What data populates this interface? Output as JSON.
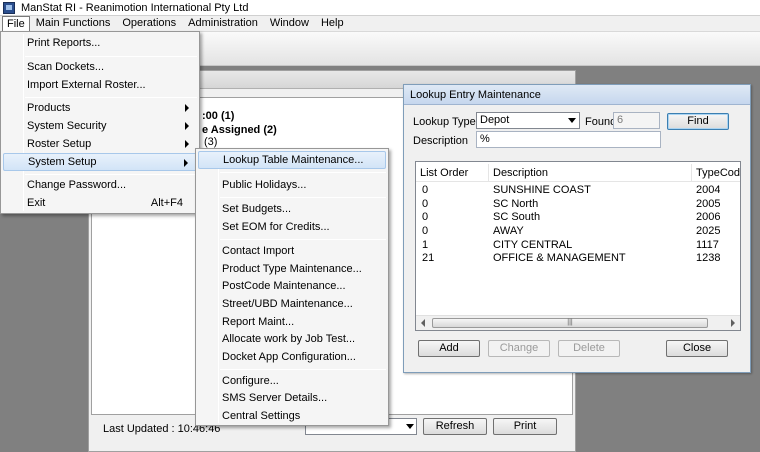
{
  "window": {
    "title": "ManStat RI - Reanimotion International Pty Ltd"
  },
  "menubar": [
    "File",
    "Main Functions",
    "Operations",
    "Administration",
    "Window",
    "Help"
  ],
  "file_menu": {
    "items": [
      {
        "label": "Print Reports..."
      },
      {
        "label": "Scan Dockets..."
      },
      {
        "label": "Import External Roster..."
      },
      {
        "label": "Products"
      },
      {
        "label": "System Security"
      },
      {
        "label": "Roster Setup"
      },
      {
        "label": "System Setup"
      },
      {
        "label": "Change Password..."
      },
      {
        "label": "Exit",
        "shortcut": "Alt+F4"
      }
    ]
  },
  "system_setup_menu": {
    "items": [
      "Lookup Table Maintenance...",
      "Public Holidays...",
      "Set Budgets...",
      "Set EOM for Credits...",
      "Contact Import",
      "Product Type Maintenance...",
      "PostCode Maintenance...",
      "Street/UBD Maintenance...",
      "Report Maint...",
      "Allocate work by Job Test...",
      "Docket App Configuration...",
      "Configure...",
      "SMS Server Details...",
      "Central Settings"
    ]
  },
  "background_window": {
    "line1": ":00    (1)",
    "line2": "e Assigned     (2)",
    "line3": "(3)",
    "last_updated": "Last Updated : 10:46:46",
    "refresh_label": "Refresh",
    "print_label": "Print"
  },
  "lookup_dialog": {
    "title": "Lookup Entry Maintenance",
    "lookup_type_label": "Lookup Type",
    "lookup_type_value": "Depot",
    "found_label": "Found",
    "found_value": "6",
    "find_label": "Find",
    "description_label": "Description",
    "description_value": "%",
    "columns": [
      "List Order",
      "Description",
      "TypeCod"
    ],
    "rows": [
      {
        "order": "0",
        "description": "SUNSHINE COAST",
        "code": "2004"
      },
      {
        "order": "0",
        "description": "SC North",
        "code": "2005"
      },
      {
        "order": "0",
        "description": "SC South",
        "code": "2006"
      },
      {
        "order": "0",
        "description": "AWAY",
        "code": "2025"
      },
      {
        "order": "1",
        "description": "CITY CENTRAL",
        "code": "1117"
      },
      {
        "order": "21",
        "description": "OFFICE & MANAGEMENT",
        "code": "1238"
      }
    ],
    "add_label": "Add",
    "change_label": "Change",
    "delete_label": "Delete",
    "close_label": "Close"
  }
}
